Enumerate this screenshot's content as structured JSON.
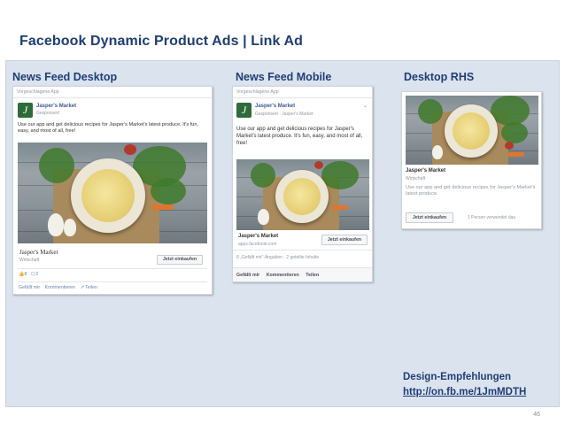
{
  "slide": {
    "title": "Facebook Dynamic Product Ads | Link Ad",
    "page_number": "46"
  },
  "columns": {
    "desktop_label": "News Feed Desktop",
    "mobile_label": "News Feed Mobile",
    "rhs_label": "Desktop RHS"
  },
  "desktop_ad": {
    "suggested_header": "Vorgeschlagene App",
    "brand": "Jasper's Market",
    "sponsored": "Gesponsert",
    "body": "Use our app and get delicious recipes for Jasper's Market's latest produce. It's fun, easy, and most of all, free!",
    "product_title": "Jasper's Market",
    "product_sub": "Wirtschaft",
    "cta": "Jetzt einkaufen",
    "likes": "8",
    "comments": "2",
    "action_like": "Gefällt mir",
    "action_comment": "Kommentieren",
    "action_share": "Teilen"
  },
  "mobile_ad": {
    "suggested_header": "Vorgeschlagene App",
    "brand": "Jasper's Market",
    "sponsored": "Gesponsert · Jasper's Market",
    "body": "Use our app and get delicious recipes for Jasper's Market's latest produce. It's fun, easy, and most of all, free!",
    "product_title": "Jasper's Market",
    "product_url": "apps.facebook.com",
    "cta": "Jetzt einkaufen",
    "counts": "8 „Gefällt mir“-Angaben · 2 geteilte Inhalte",
    "action_like": "Gefällt mir",
    "action_comment": "Kommentieren",
    "action_share": "Teilen"
  },
  "rhs_ad": {
    "title": "Jasper's Market",
    "sub": "Wirtschaft",
    "body": "Use our app and get delicious recipes for Jasper's Market's latest produce.",
    "cta": "Jetzt einkaufen",
    "social": "1 Person verwendet das"
  },
  "design": {
    "label": "Design-Empfehlungen",
    "link": "http://on.fb.me/1JmMDTH"
  },
  "colors": {
    "title_blue": "#1f3e75",
    "panel_bg": "#dbe3ee",
    "fb_blue": "#3b5998"
  }
}
